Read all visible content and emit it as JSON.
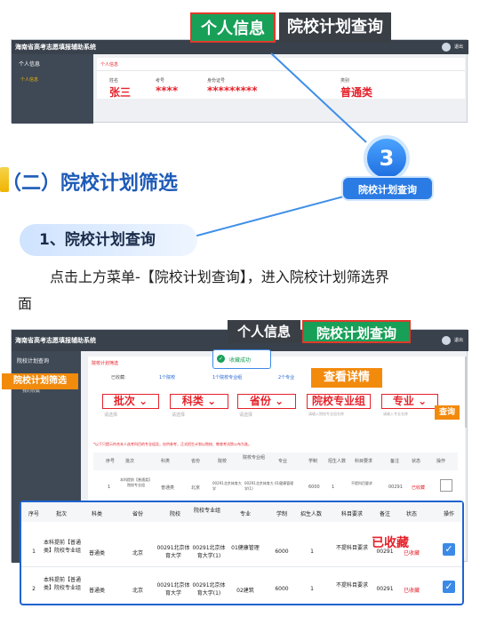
{
  "top_screenshot": {
    "app_title": "海南省高考志愿填报辅助系统",
    "sidebar_menu": "个人信息",
    "sidebar_sub": "个人信息",
    "breadcrumb": "个人信息",
    "row_labels": [
      "姓名",
      "考号",
      "身份证号",
      "类别"
    ],
    "row_values": [
      "张三",
      "****",
      "*********",
      "普通类"
    ],
    "logout": "退出"
  },
  "callouts": {
    "personal_info": "个人信息",
    "plan_query": "院校计划查询",
    "step_number": "3",
    "step_label": "院校计划查询"
  },
  "section": {
    "heading": "（二）院校计划筛选",
    "subheading": "1、院校计划查询",
    "paragraph": "点击上方菜单-【院校计划查询】，进入院校计划筛选界"
  },
  "bottom_screenshot": {
    "app_title": "海南省高考志愿填报辅助系统",
    "sidebar_menu": "院校计划查询",
    "sidebar_sub": "我的收藏",
    "breadcrumb": "院校计划筛选",
    "logout": "退出",
    "toast": "收藏成功",
    "counters_label": "已收藏:",
    "counters": [
      "1个院校",
      "1个院校专业组",
      "2个专业"
    ],
    "filters": [
      "批次",
      "科类",
      "省份",
      "院校专业组",
      "专业"
    ],
    "filter_placeholders": [
      "请选择",
      "请选择",
      "请选择",
      "请输入院校专业组名称",
      "请输入专业名称"
    ],
    "notice": "*以下只提示符合本人选考科目的专业组及，仅供参考，正式招生计划以院校、教育考试院公布为准。",
    "header_personal": "个人信息",
    "header_plan": "院校计划查询",
    "badge_detail": "查看详情",
    "badge_filter": "院校计划筛选",
    "badge_query": "查询",
    "inner_headers": [
      "序号",
      "批次",
      "科类",
      "省份",
      "院校",
      "院校专业组",
      "专业",
      "学制",
      "招生人数",
      "科目要求",
      "备注",
      "状态",
      "操作"
    ],
    "inner_row": [
      "1",
      "本科提前【普通类】院校专业组",
      "普通类",
      "北京",
      "00291北京体育大学",
      "00291北京体育大学(1)",
      "01健康管理",
      "6000",
      "1",
      "不提科目要求",
      "00291",
      "已收藏"
    ]
  },
  "zoom_table": {
    "headers": [
      "序号",
      "批次",
      "科类",
      "省份",
      "院校",
      "院校专业组",
      "专业",
      "学制",
      "招生人数",
      "科目要求",
      "备注",
      "状态",
      "操作"
    ],
    "rows": [
      [
        "1",
        "本科提前【普通类】院校专业组",
        "普通类",
        "北京",
        "00291北京体育大学",
        "00291北京体育大学(1)",
        "01健康管理",
        "6000",
        "1",
        "不提科目要求",
        "00291",
        "已收藏"
      ],
      [
        "2",
        "本科提前【普通类】院校专业组",
        "普通类",
        "北京",
        "00291北京体育大学",
        "00291北京体育大学(1)",
        "02建筑",
        "6000",
        "1",
        "不提科目要求",
        "00291",
        "已收藏"
      ]
    ],
    "collected_label": "已收藏"
  }
}
